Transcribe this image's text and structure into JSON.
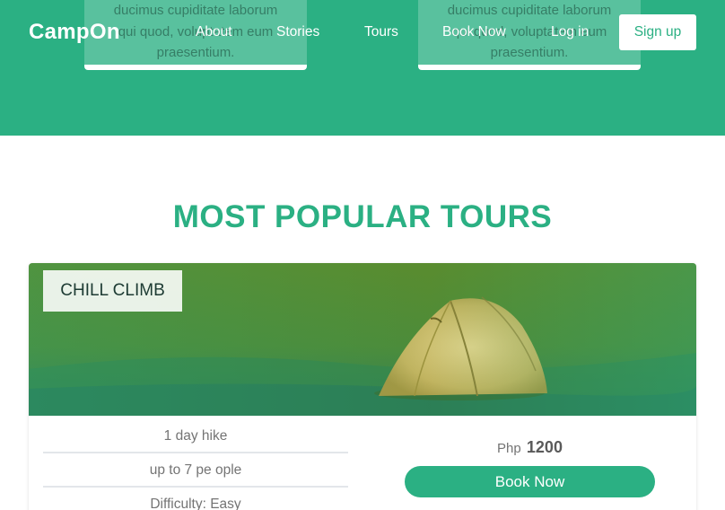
{
  "brand": "CampOn",
  "nav": {
    "about": "About",
    "stories": "Stories",
    "tours": "Tours",
    "book_now": "Book Now",
    "login": "Log in",
    "signup": "Sign up"
  },
  "feature_cards": [
    {
      "line1": "ducimus cupiditate laborum",
      "line2": "qui quod, voluptatem eum",
      "line3": "praesentium."
    },
    {
      "line1": "ducimus cupiditate laborum",
      "line2": "qui quod, voluptatem eum",
      "line3": "praesentium."
    }
  ],
  "section_title": "MOST POPULAR TOURS",
  "tour": {
    "name": "CHILL CLIMB",
    "details": [
      "1 day hike",
      "up to 7 pe ople",
      "Difficulty: Easy"
    ],
    "price_currency": "Php",
    "price_value": "1200",
    "book_label": "Book Now"
  },
  "colors": {
    "accent": "#2bb083",
    "white": "#ffffff"
  },
  "icons": {
    "tent": "tent-illustration"
  }
}
